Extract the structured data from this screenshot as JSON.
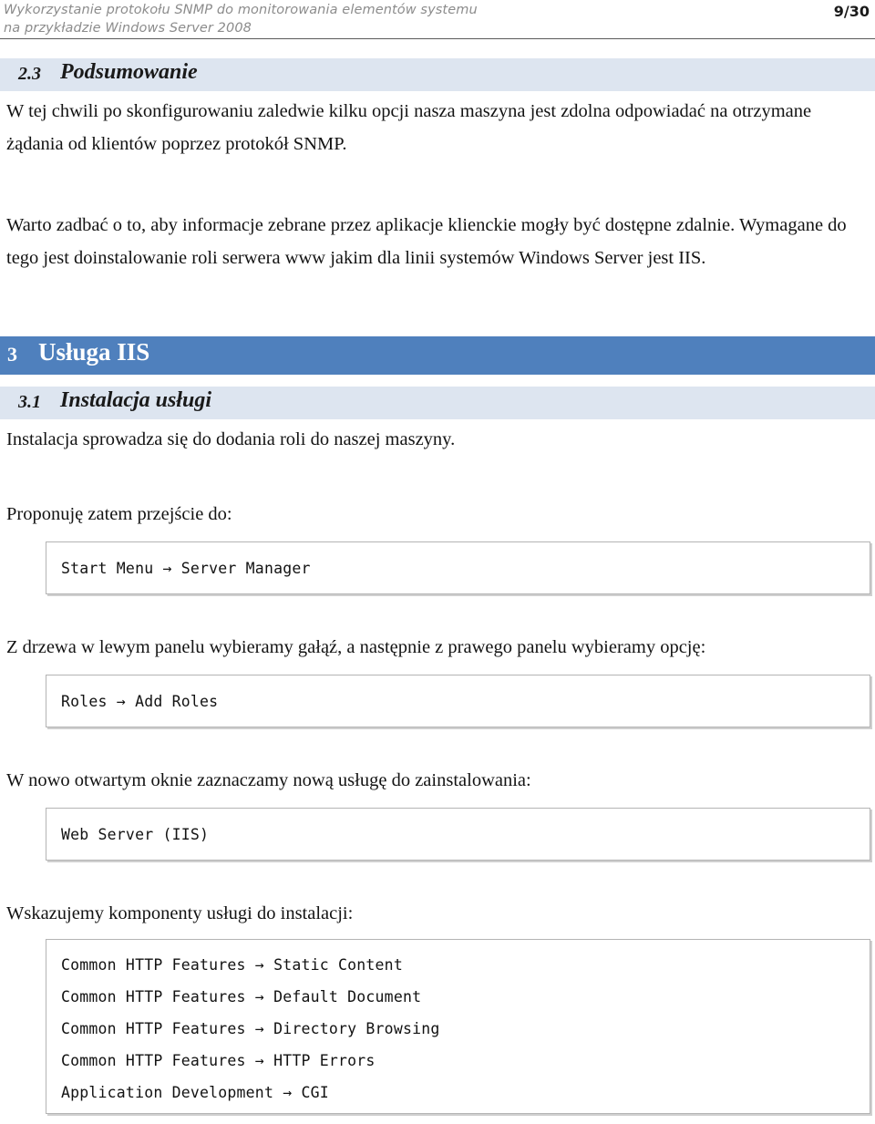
{
  "header": {
    "title_line1": "Wykorzystanie protokołu SNMP do monitorowania elementów systemu",
    "title_line2": "na przykładzie Windows Server 2008",
    "page_number": "9/30"
  },
  "colors": {
    "section_band": "#4f80bd",
    "subsection_band": "#dde5f0",
    "header_text": "#8c8c8c",
    "body_text": "#131313",
    "code_border": "#b4b4b4"
  },
  "sections": {
    "podsumowanie": {
      "number": "2.3",
      "title": "Podsumowanie",
      "paragraph": "W tej chwili po skonfigurowaniu zaledwie kilku opcji nasza maszyna jest zdolna odpowiadać na otrzymane żądania od klientów poprzez protokół SNMP.",
      "paragraph2": "Warto zadbać o to, aby informacje zebrane przez aplikacje klienckie mogły być dostępne zdalnie. Wymagane do tego jest doinstalowanie roli serwera www jakim dla linii systemów Windows Server jest IIS."
    },
    "usluga_iis": {
      "number": "3",
      "title": "Usługa IIS"
    },
    "instalacja_uslugi": {
      "number": "3.1",
      "title": "Instalacja usługi",
      "paragraph": "Instalacja sprowadza się do dodania roli do naszej maszyny.",
      "intro1": "Proponuję zatem przejście do:",
      "code1": "Start Menu → Server Manager",
      "intro2": "Z drzewa w lewym panelu wybieramy gałąź, a następnie z prawego panelu wybieramy opcję:",
      "code2": "Roles → Add Roles",
      "intro3": "W nowo otwartym oknie zaznaczamy nową usługę do zainstalowania:",
      "code3": "Web Server (IIS)",
      "intro4": "Wskazujemy komponenty usługi do instalacji:",
      "code4_lines": [
        "Common HTTP Features → Static Content",
        "Common HTTP Features → Default Document",
        "Common HTTP Features → Directory Browsing",
        "Common HTTP Features → HTTP Errors",
        "Application Development → CGI"
      ]
    }
  }
}
